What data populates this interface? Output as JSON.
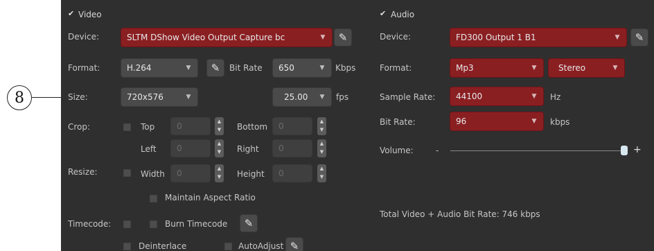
{
  "callout": {
    "number": "8"
  },
  "video": {
    "checkbox_label": "Video",
    "device_label": "Device:",
    "device_value": "SLTM DShow  Video Output Capture bc",
    "format_label": "Format:",
    "format_value": "H.264",
    "bitrate_label": "Bit Rate",
    "bitrate_value": "650",
    "bitrate_unit": "Kbps",
    "size_label": "Size:",
    "size_value": "720x576",
    "fps_value": "25.00",
    "fps_unit": "fps",
    "crop_label": "Crop:",
    "top_label": "Top",
    "top_value": "0",
    "bottom_label": "Bottom",
    "bottom_value": "0",
    "left_label": "Left",
    "left_value": "0",
    "right_label": "Right",
    "right_value": "0",
    "resize_label": "Resize:",
    "width_label": "Width",
    "width_value": "0",
    "height_label": "Height",
    "height_value": "0",
    "maintain_label": "Maintain Aspect Ratio",
    "timecode_label": "Timecode:",
    "burn_label": "Burn Timecode",
    "deinterlace_label": "Deinterlace",
    "autoadjust_label": "AutoAdjust"
  },
  "audio": {
    "checkbox_label": "Audio",
    "device_label": "Device:",
    "device_value": "FD300 Output 1 B1",
    "format_label": "Format:",
    "format_value": "Mp3",
    "channels_value": "Stereo",
    "samplerate_label": "Sample Rate:",
    "samplerate_value": "44100",
    "samplerate_unit": "Hz",
    "bitrate_label": "Bit Rate:",
    "bitrate_value": "96",
    "bitrate_unit": "kbps",
    "volume_label": "Volume:",
    "volume_minus": "-",
    "volume_plus": "+",
    "volume_level": 1.0
  },
  "total": {
    "text": "Total Video + Audio Bit Rate: 746 kbps"
  },
  "icons": {
    "settings": "wrench-icon",
    "dropdown": "chevron-down-icon",
    "spinner": "spinner-arrows-icon"
  }
}
